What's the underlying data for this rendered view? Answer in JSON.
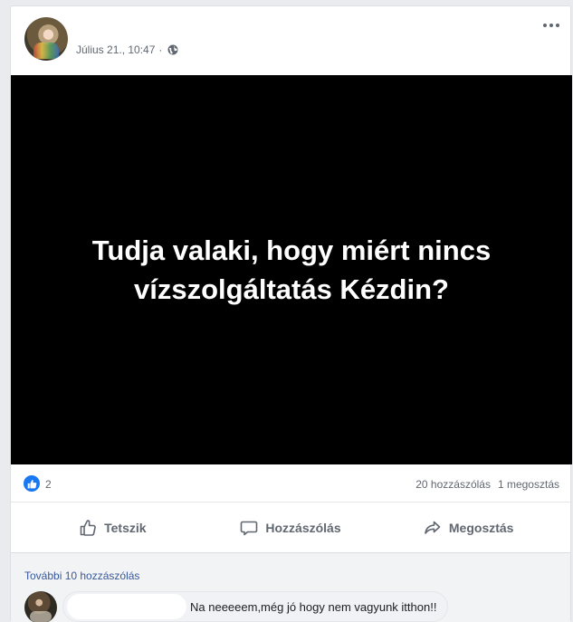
{
  "post": {
    "timestamp": "Július 21., 10:47",
    "separator": "·",
    "privacy_icon": "globe-icon",
    "image_text_line1": "Tudja valaki, hogy miért nincs",
    "image_text_line2": "vízszolgáltatás Kézdin?"
  },
  "stats": {
    "reaction_icon": "like-icon",
    "reaction_count": "2",
    "comments": "20 hozzászólás",
    "shares": "1 megosztás"
  },
  "actions": {
    "like": "Tetszik",
    "comment": "Hozzászólás",
    "share": "Megosztás"
  },
  "comments": {
    "more_link": "További 10 hozzászólás",
    "first_comment_text": "Na neeeeem,még jó hogy nem vagyunk itthon!!"
  },
  "colors": {
    "accent": "#1877f2",
    "link": "#385898",
    "muted_text": "#606770",
    "media_bg": "#000000"
  }
}
